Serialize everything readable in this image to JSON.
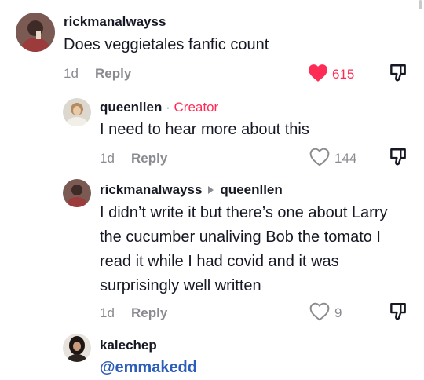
{
  "comments": [
    {
      "username": "rickmanalwayss",
      "text": "Does veggietales fanfic count",
      "time": "1d",
      "reply_label": "Reply",
      "likes": "615",
      "liked": true
    },
    {
      "username": "queenllen",
      "separator": "·",
      "badge": "Creator",
      "text": "I need to hear more about this",
      "time": "1d",
      "reply_label": "Reply",
      "likes": "144",
      "liked": false
    },
    {
      "username": "rickmanalwayss",
      "reply_to": "queenllen",
      "text": "I didn’t write it but there’s one about Larry the cucumber unaliving Bob the tomato I read it while I had covid and it was surprisingly well written",
      "time": "1d",
      "reply_label": "Reply",
      "likes": "9",
      "liked": false
    },
    {
      "username": "kalechep",
      "mention": "@emmakedd"
    }
  ],
  "colors": {
    "liked": "#fe2c55",
    "muted": "#8a8b91",
    "mention": "#2b5db9",
    "text": "#161823"
  }
}
